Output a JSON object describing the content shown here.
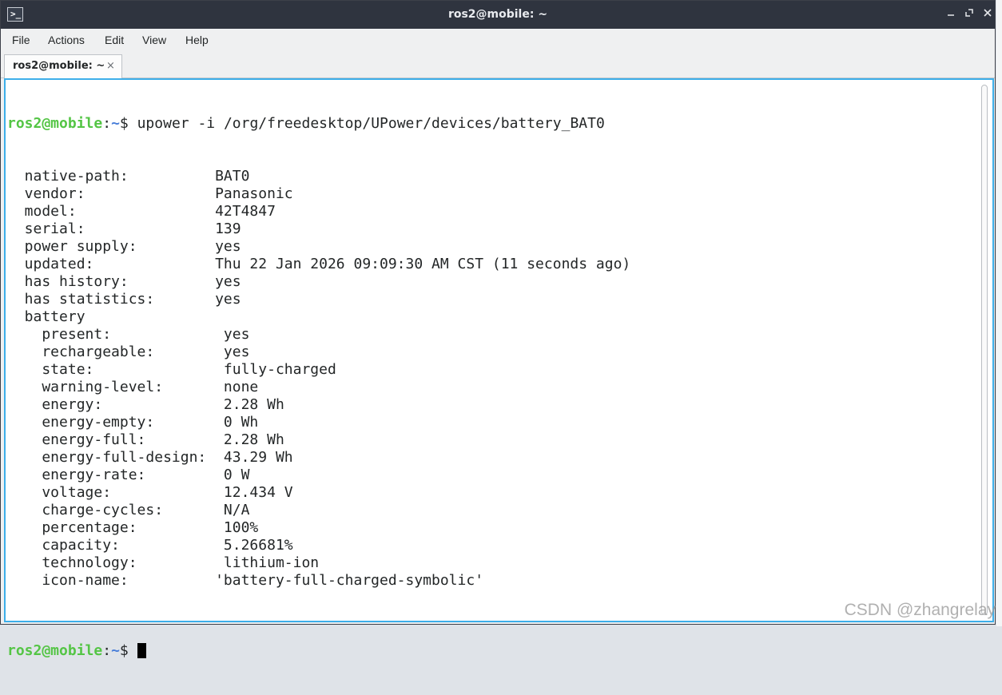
{
  "window": {
    "title": "ros2@mobile: ~"
  },
  "menu": [
    "File",
    "Actions",
    "Edit",
    "View",
    "Help"
  ],
  "tab": {
    "label": "ros2@mobile: ~",
    "close_glyph": "×"
  },
  "prompt": {
    "user_host": "ros2@mobile",
    "colon": ":",
    "path": "~",
    "symbol": "$ "
  },
  "command": "upower -i /org/freedesktop/UPower/devices/battery_BAT0",
  "output": [
    "  native-path:          BAT0",
    "  vendor:               Panasonic",
    "  model:                42T4847",
    "  serial:               139",
    "  power supply:         yes",
    "  updated:              Thu 22 Jan 2026 09:09:30 AM CST (11 seconds ago)",
    "  has history:          yes",
    "  has statistics:       yes",
    "  battery",
    "    present:             yes",
    "    rechargeable:        yes",
    "    state:               fully-charged",
    "    warning-level:       none",
    "    energy:              2.28 Wh",
    "    energy-empty:        0 Wh",
    "    energy-full:         2.28 Wh",
    "    energy-full-design:  43.29 Wh",
    "    energy-rate:         0 W",
    "    voltage:             12.434 V",
    "    charge-cycles:       N/A",
    "    percentage:          100%",
    "    capacity:            5.26681%",
    "    technology:          lithium-ion",
    "    icon-name:          'battery-full-charged-symbolic'",
    ""
  ],
  "watermark": "CSDN @zhangrelay",
  "icons": {
    "app": "terminal-icon",
    "minimize": "minimize-icon",
    "maximize": "maximize-icon",
    "close": "close-icon"
  },
  "colors": {
    "titlebar": "#2f343f",
    "prompt_user": "#54c545",
    "prompt_path": "#4a7fd9",
    "focus_border": "#3daee9"
  }
}
